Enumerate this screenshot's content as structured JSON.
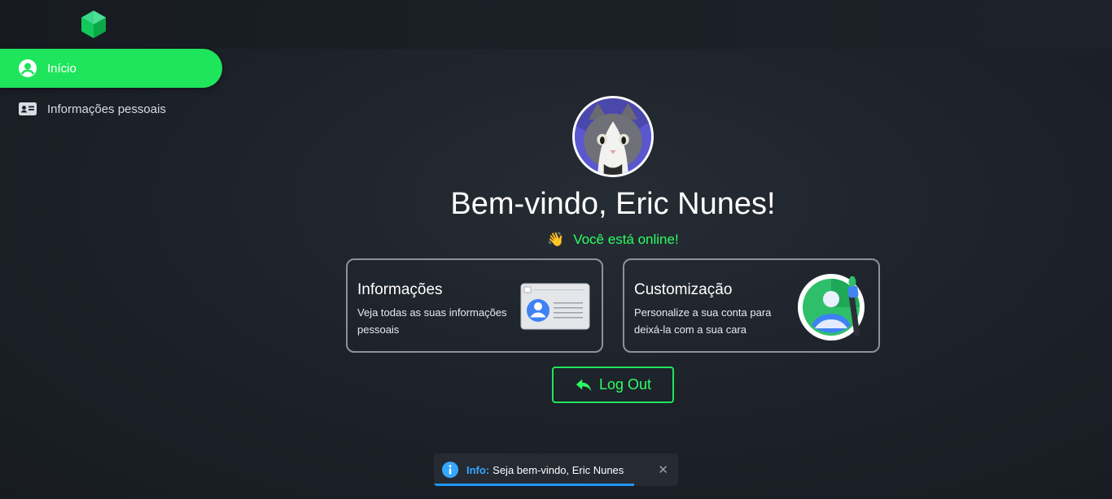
{
  "sidebar": {
    "items": [
      {
        "label": "Início",
        "icon": "user-circle-icon",
        "active": true
      },
      {
        "label": "Informações pessoais",
        "icon": "id-card-icon",
        "active": false
      }
    ]
  },
  "main": {
    "welcome": "Bem-vindo, Eric Nunes!",
    "status_emoji": "👋",
    "status": "Você está online!",
    "cards": [
      {
        "title": "Informações",
        "description": "Veja todas as suas informações pessoais",
        "icon": "id-card-illustration-icon"
      },
      {
        "title": "Customização",
        "description": "Personalize a sua conta para deixá-la com a sua cara",
        "icon": "profile-paintbrush-icon"
      }
    ],
    "logout_label": "Log Out"
  },
  "toast": {
    "label": "Info:",
    "message": "Seja bem-vindo, Eric Nunes",
    "close": "✕",
    "progress": 0.82
  },
  "colors": {
    "accent": "#1fe55c",
    "online": "#2cff62",
    "info": "#35a7ff",
    "background": "#1b2028"
  }
}
